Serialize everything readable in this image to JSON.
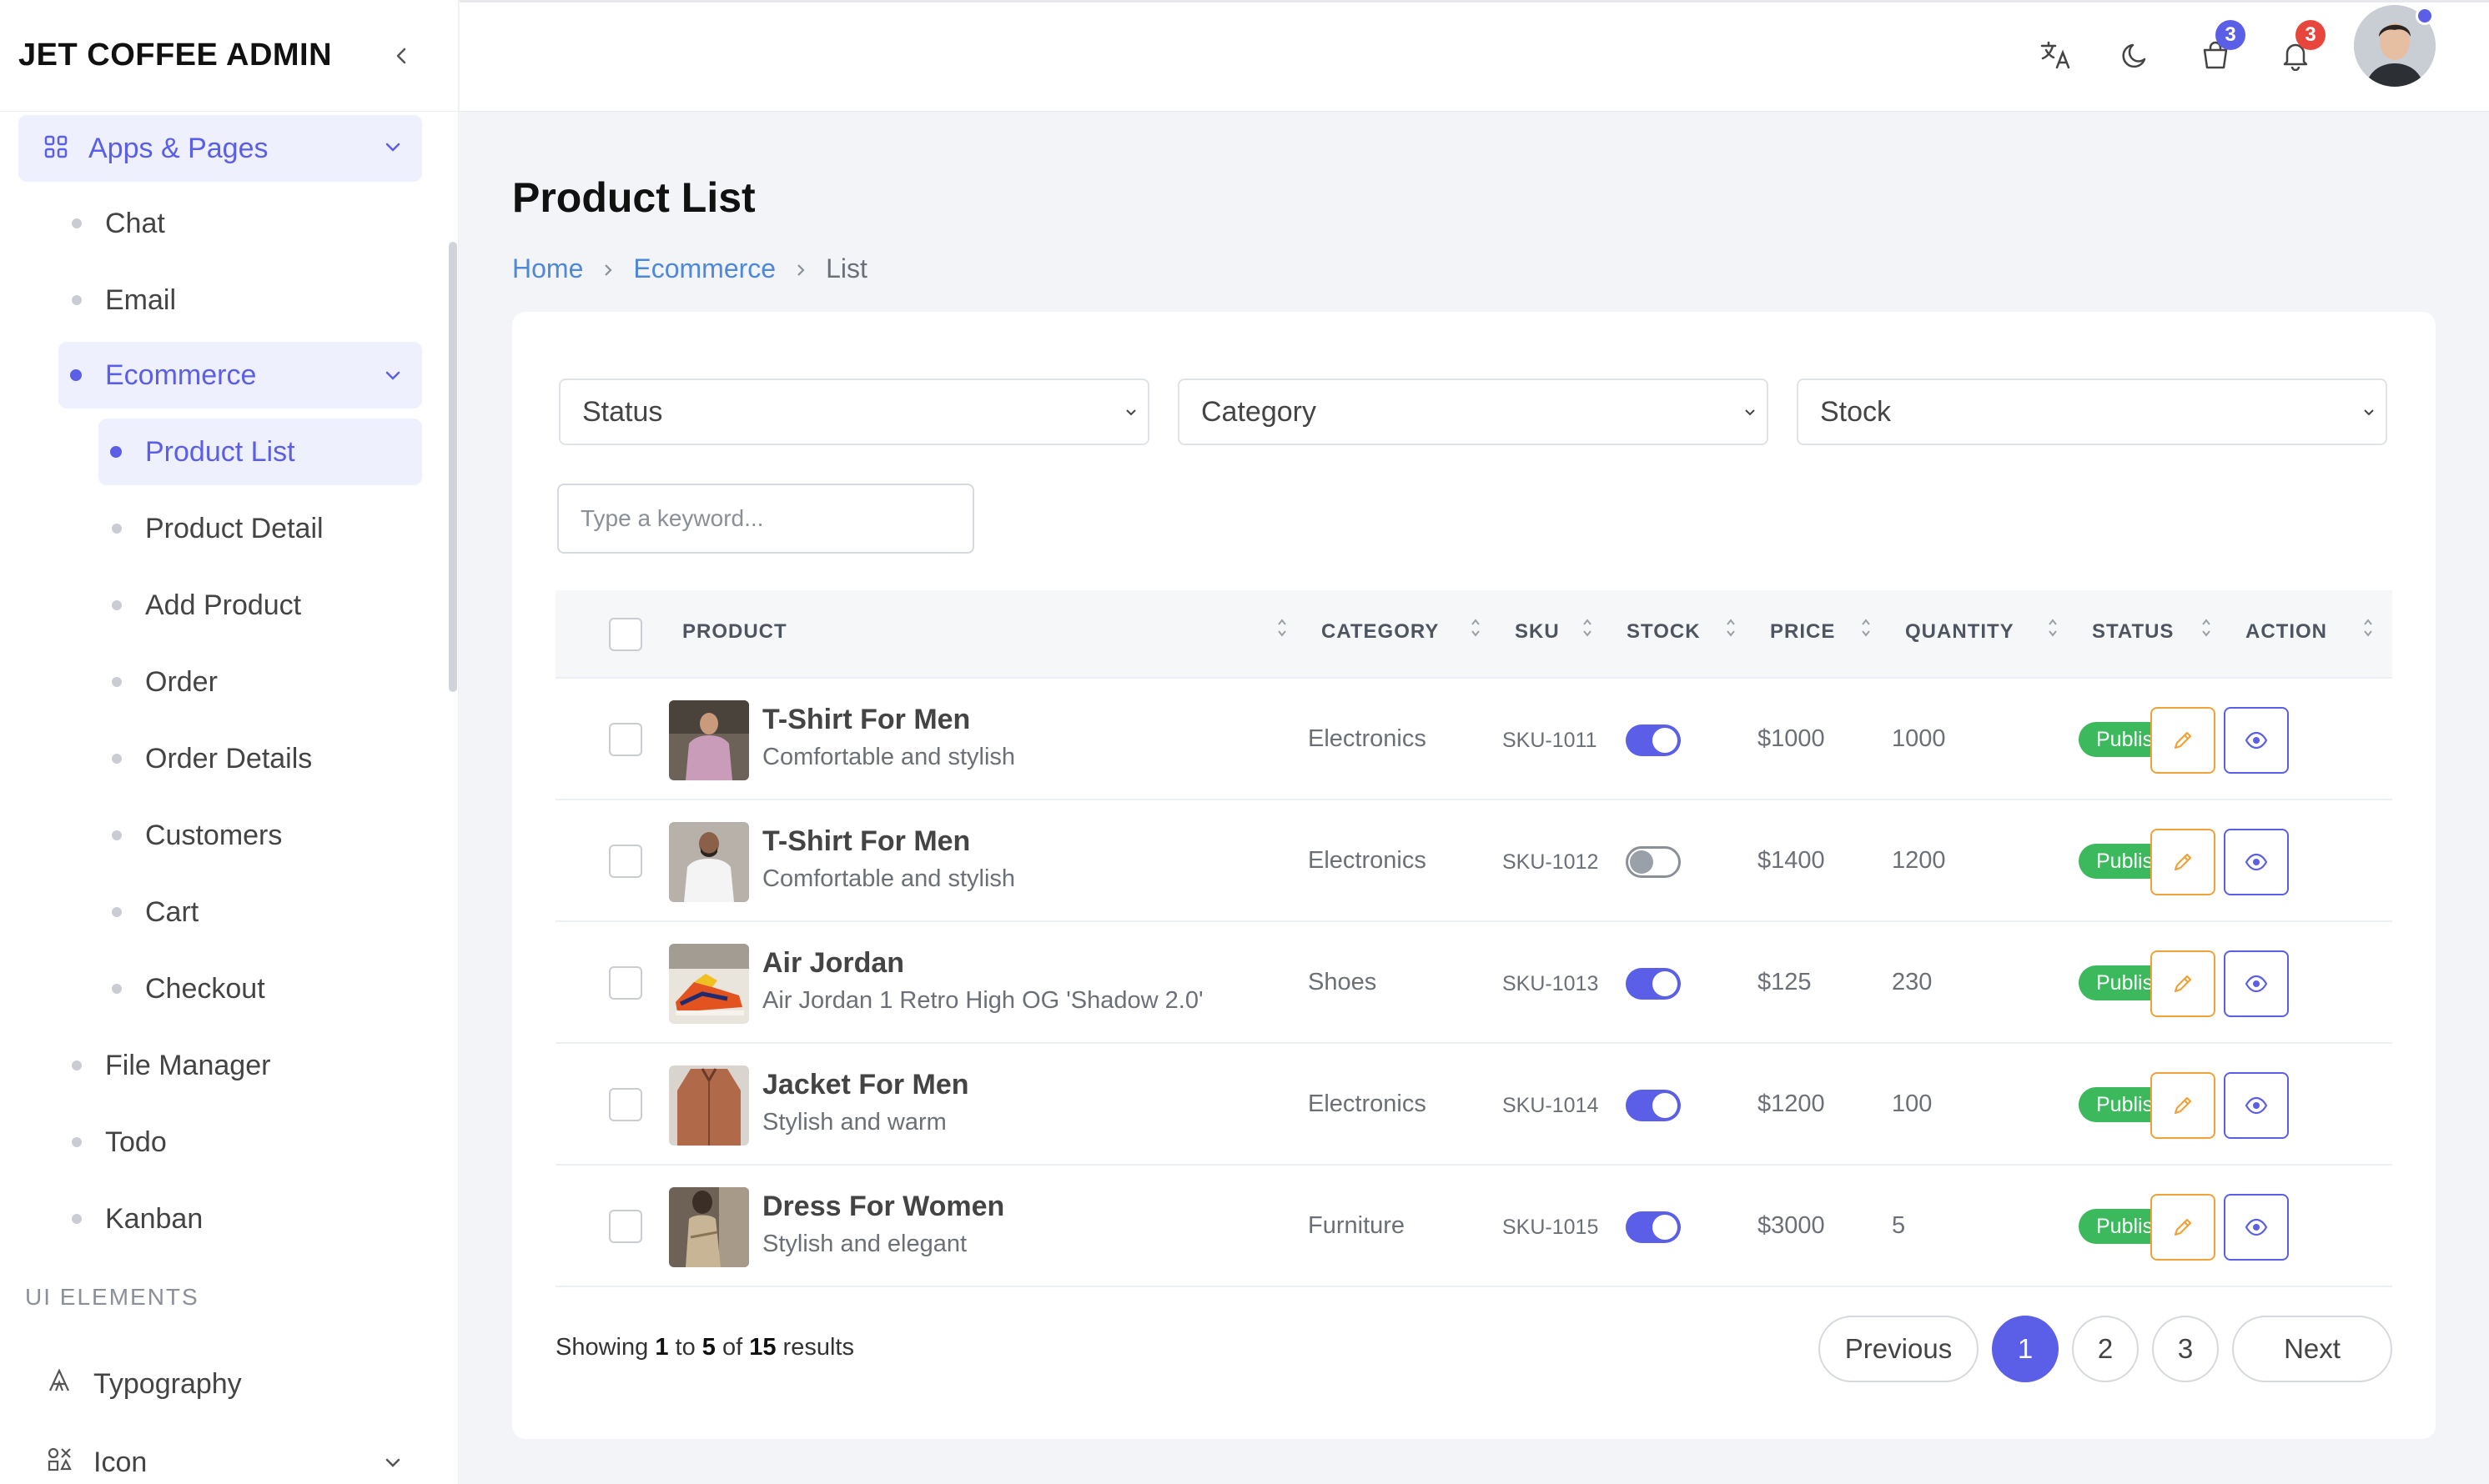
{
  "brand": {
    "title": "JET COFFEE ADMIN"
  },
  "sidebar": {
    "apps_group": "Apps & Pages",
    "items": {
      "chat": "Chat",
      "email": "Email",
      "ecommerce": "Ecommerce",
      "product_list": "Product List",
      "product_detail": "Product Detail",
      "add_product": "Add Product",
      "order": "Order",
      "order_details": "Order Details",
      "customers": "Customers",
      "cart": "Cart",
      "checkout": "Checkout",
      "file_manager": "File Manager",
      "todo": "Todo",
      "kanban": "Kanban"
    },
    "ui_section": "UI ELEMENTS",
    "typography": "Typography",
    "icon": "Icon"
  },
  "topbar": {
    "cart_count": "3",
    "notification_count": "3",
    "colors": {
      "cart_badge": "#5b5ee6",
      "notification_badge": "#e8453c"
    }
  },
  "page": {
    "title": "Product List",
    "breadcrumb": {
      "home": "Home",
      "ecommerce": "Ecommerce",
      "current": "List"
    }
  },
  "filters": {
    "status": "Status",
    "category": "Category",
    "stock": "Stock",
    "search_placeholder": "Type a keyword..."
  },
  "table": {
    "headers": {
      "product": "PRODUCT",
      "category": "CATEGORY",
      "sku": "SKU",
      "stock": "STOCK",
      "price": "PRICE",
      "quantity": "QUANTITY",
      "status": "STATUS",
      "action": "ACTION"
    },
    "rows": [
      {
        "name": "T-Shirt For Men",
        "desc": "Comfortable and stylish",
        "category": "Electronics",
        "sku": "SKU-1011",
        "stock": true,
        "price": "$1000",
        "quantity": "1000",
        "status": "Publish"
      },
      {
        "name": "T-Shirt For Men",
        "desc": "Comfortable and stylish",
        "category": "Electronics",
        "sku": "SKU-1012",
        "stock": false,
        "price": "$1400",
        "quantity": "1200",
        "status": "Publish"
      },
      {
        "name": "Air Jordan",
        "desc": "Air Jordan 1 Retro High OG 'Shadow 2.0'",
        "category": "Shoes",
        "sku": "SKU-1013",
        "stock": true,
        "price": "$125",
        "quantity": "230",
        "status": "Publish"
      },
      {
        "name": "Jacket For Men",
        "desc": "Stylish and warm",
        "category": "Electronics",
        "sku": "SKU-1014",
        "stock": true,
        "price": "$1200",
        "quantity": "100",
        "status": "Publish"
      },
      {
        "name": "Dress For Women",
        "desc": "Stylish and elegant",
        "category": "Furniture",
        "sku": "SKU-1015",
        "stock": true,
        "price": "$3000",
        "quantity": "5",
        "status": "Publish"
      }
    ]
  },
  "pagination": {
    "showing_prefix": "Showing",
    "from": "1",
    "to_word": "to",
    "to": "5",
    "of_word": "of",
    "total": "15",
    "results_word": "results",
    "previous": "Previous",
    "pages": [
      "1",
      "2",
      "3"
    ],
    "next": "Next",
    "current_page": "1"
  }
}
